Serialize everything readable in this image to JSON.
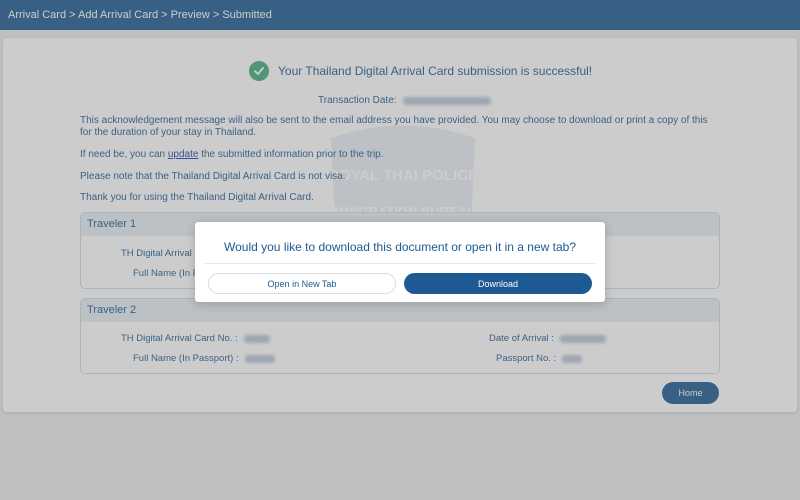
{
  "breadcrumb": {
    "items": [
      "Arrival Card",
      "Add Arrival Card",
      "Preview",
      "Submitted"
    ],
    "separator": " > "
  },
  "success": {
    "message": "Your Thailand Digital Arrival Card submission is successful!",
    "icon": "check-circle-icon",
    "color": "#3fae7c"
  },
  "transaction": {
    "label": "Transaction Date:"
  },
  "paragraphs": {
    "p1": "This acknowledgement message will also be sent to the email address you have provided. You may choose to download or print a copy of this for the duration of your stay in Thailand.",
    "p2_before": "If need be, you can ",
    "p2_link": "update",
    "p2_after": " the submitted information prior to the trip.",
    "p3": "Please note that the Thailand Digital Arrival Card is not visa.",
    "p4": "Thank you for using the Thailand Digital Arrival Card."
  },
  "watermark": {
    "line1": "ROYAL THAI POLICE",
    "line2": "IMMIGRATION BUREAU"
  },
  "travelers": [
    {
      "title": "Traveler 1",
      "card_no_label": "TH Digital Arrival Card No. :",
      "full_name_label": "Full Name (In Passport) :"
    },
    {
      "title": "Traveler 2",
      "card_no_label": "TH Digital Arrival Card No. :",
      "full_name_label": "Full Name (In Passport) :",
      "arrival_label": "Date of Arrival :",
      "passport_label": "Passport No. :"
    }
  ],
  "home_button": "Home",
  "modal": {
    "title": "Would you like to download this document or open it in a new tab?",
    "open_label": "Open in New Tab",
    "download_label": "Download"
  },
  "colors": {
    "brand": "#1d5a93",
    "success": "#3fae7c"
  }
}
